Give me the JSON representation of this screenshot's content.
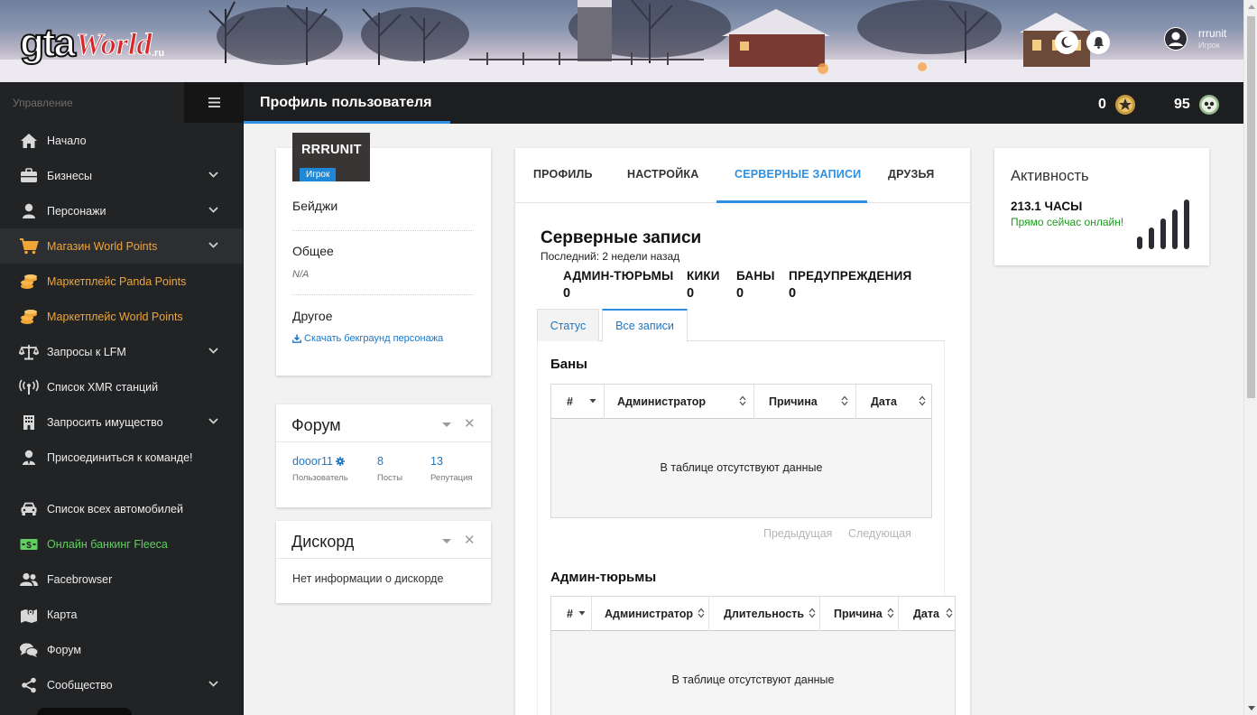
{
  "header": {
    "logo_text": "gtaWorld.ru",
    "user_name": "rrrunit",
    "user_role": "Игрок",
    "moon_icon": "moon-icon",
    "bell_icon": "bell-icon"
  },
  "sidebar": {
    "section_label": "Управление",
    "items": [
      {
        "label": "Начало",
        "icon": "home-icon"
      },
      {
        "label": "Бизнесы",
        "icon": "briefcase-icon",
        "has_chevron": true
      },
      {
        "label": "Персонажи",
        "icon": "user-icon",
        "has_chevron": true
      },
      {
        "label": "Магазин World Points",
        "icon": "cart-icon",
        "has_chevron": true,
        "color": "#f0a537",
        "active": true
      },
      {
        "label": "Маркетплейс Panda Points",
        "icon": "coins-icon",
        "color": "#f0a537"
      },
      {
        "label": "Маркетплейс World Points",
        "icon": "coins-icon",
        "color": "#f0a537"
      },
      {
        "label": "Запросы к LFM",
        "icon": "scale-icon",
        "has_chevron": true
      },
      {
        "label": "Список XMR станций",
        "icon": "antenna-icon"
      },
      {
        "label": "Запросить имущество",
        "icon": "building-icon",
        "has_chevron": true
      },
      {
        "label": "Присоединиться к команде!",
        "icon": "user-tie-icon"
      },
      {
        "label": "Список всех автомобилей",
        "icon": "car-icon"
      },
      {
        "label": "Онлайн банкинг Fleeca",
        "icon": "money-icon",
        "color": "#5fd15f"
      },
      {
        "label": "Facebrowser",
        "icon": "users-icon"
      },
      {
        "label": "Карта",
        "icon": "map-icon"
      },
      {
        "label": "Форум",
        "icon": "comments-icon"
      },
      {
        "label": "Сообщество",
        "icon": "share-icon",
        "has_chevron": true
      }
    ]
  },
  "titlebar": {
    "title": "Профиль пользователя",
    "points_value": "0",
    "coins_value": "95"
  },
  "profile": {
    "name": "RRRUNIT",
    "role": "Игрок",
    "badges_label": "Бейджи",
    "general_label": "Общее",
    "general_value": "N/A",
    "other_label": "Другое",
    "download_link": "Скачать бекграунд персонажа"
  },
  "forum": {
    "title": "Форум",
    "username": "dooor11",
    "username_label": "Пользователь",
    "posts": "8",
    "posts_label": "Посты",
    "reputation": "13",
    "reputation_label": "Репутация"
  },
  "discord": {
    "title": "Дискорд",
    "text": "Нет информации о дискорде"
  },
  "main": {
    "tabs": [
      "ПРОФИЛЬ",
      "НАСТРОЙКА",
      "СЕРВЕРНЫЕ ЗАПИСИ",
      "ДРУЗЬЯ"
    ],
    "active_tab": "СЕРВЕРНЫЕ ЗАПИСИ",
    "records_title": "Серверные записи",
    "records_last": "Последний: 2 недели назад",
    "counters": [
      {
        "label": "АДМИН-ТЮРЬМЫ",
        "value": "0"
      },
      {
        "label": "КИКИ",
        "value": "0"
      },
      {
        "label": "БАНЫ",
        "value": "0"
      },
      {
        "label": "ПРЕДУПРЕЖДЕНИЯ",
        "value": "0"
      }
    ],
    "sub_tabs": [
      "Статус",
      "Все записи"
    ],
    "bans": {
      "title": "Баны",
      "columns": [
        "#",
        "Администратор",
        "Причина",
        "Дата"
      ],
      "empty": "В таблице отсутствуют данные",
      "prev": "Предыдущая",
      "next": "Следующая"
    },
    "jails": {
      "title": "Админ-тюрьмы",
      "columns": [
        "#",
        "Администратор",
        "Длительность",
        "Причина",
        "Дата"
      ],
      "empty": "В таблице отсутствуют данные"
    }
  },
  "activity": {
    "title": "Активность",
    "hours": "213.1 ЧАСЫ",
    "status": "Прямо сейчас онлайн!"
  },
  "colors": {
    "accent": "#2f8fe0",
    "sidebar_bg": "#222325",
    "orange": "#f0a537",
    "green": "#5fd15f"
  }
}
